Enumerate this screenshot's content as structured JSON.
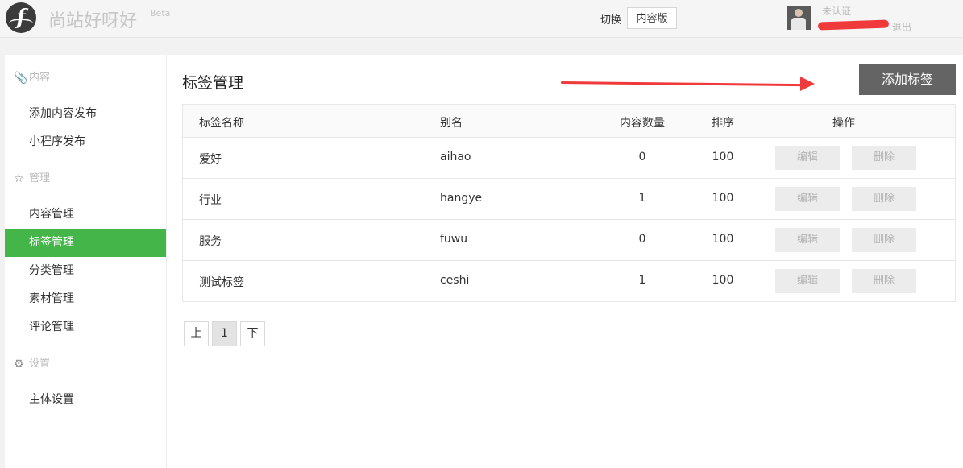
{
  "header": {
    "site_name": "尚站好呀好",
    "site_badge": "Beta",
    "switch_label": "切换",
    "switch_button": "内容版",
    "verify_status": "未认证",
    "logout": "退出"
  },
  "sidebar": {
    "groups": [
      {
        "icon": "paperclip-icon",
        "label": "内容",
        "items": [
          "添加内容发布",
          "小程序发布"
        ]
      },
      {
        "icon": "star-icon",
        "label": "管理",
        "items": [
          "内容管理",
          "标签管理",
          "分类管理",
          "素材管理",
          "评论管理"
        ]
      },
      {
        "icon": "gear-icon",
        "label": "设置",
        "items": [
          "主体设置"
        ]
      }
    ],
    "active_item": "标签管理"
  },
  "main": {
    "title": "标签管理",
    "add_button": "添加标签",
    "table": {
      "headers": [
        "标签名称",
        "别名",
        "内容数量",
        "排序",
        "操作"
      ],
      "rows": [
        {
          "name": "爱好",
          "alias": "aihao",
          "count": "0",
          "sort": "100"
        },
        {
          "name": "行业",
          "alias": "hangye",
          "count": "1",
          "sort": "100"
        },
        {
          "name": "服务",
          "alias": "fuwu",
          "count": "0",
          "sort": "100"
        },
        {
          "name": "测试标签",
          "alias": "ceshi",
          "count": "1",
          "sort": "100"
        }
      ],
      "edit_label": "编辑",
      "delete_label": "删除"
    },
    "pagination": {
      "prev": "上",
      "current": "1",
      "next": "下"
    }
  },
  "colors": {
    "accent": "#44b549",
    "annotation": "#f0393a",
    "add_button_bg": "#646464"
  }
}
